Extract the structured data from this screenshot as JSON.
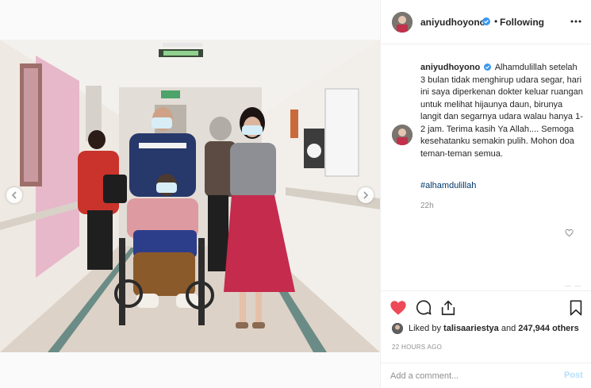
{
  "header": {
    "username": "aniyudhoyono",
    "separator": "•",
    "follow_status": "Following",
    "more_icon": "more-horizontal-icon"
  },
  "caption": {
    "username": "aniyudhoyono",
    "text": "Alhamdulillah setelah 3 bulan tidak menghirup udara segar, hari ini saya diperkenan dokter keluar ruangan untuk melihat hijaunya daun, birunya langit dan segarnya udara walau hanya 1-2 jam. Terima kasih Ya Allah.... Semoga kesehatanku semakin pulih. Mohon doa teman-teman semua.",
    "hashtag": "#alhamdulillah",
    "age": "22h"
  },
  "actions": {
    "like_icon": "heart-filled-icon",
    "comment_icon": "comment-icon",
    "share_icon": "share-icon",
    "save_icon": "bookmark-icon"
  },
  "likes": {
    "prefix": "Liked by",
    "liker": "talisaariestya",
    "conjunction": "and",
    "count": "247,944 others"
  },
  "timestamp": "22 HOURS AGO",
  "comment_box": {
    "placeholder": "Add a comment...",
    "post_label": "Post"
  },
  "colors": {
    "like_red": "#ed4956",
    "verified_blue": "#3897f0",
    "hashtag_blue": "#00376b",
    "post_disabled": "#b2dffc",
    "muted_gray": "#8e8e8e"
  }
}
